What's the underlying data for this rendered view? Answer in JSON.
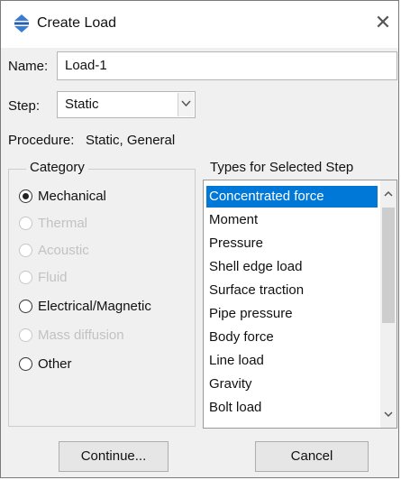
{
  "window": {
    "title": "Create Load",
    "close_glyph": "✕"
  },
  "form": {
    "name_label": "Name:",
    "name_value": "Load-1",
    "step_label": "Step:",
    "step_value": "Static",
    "procedure_label": "Procedure:",
    "procedure_value": "Static, General"
  },
  "category": {
    "legend": "Category",
    "options": [
      {
        "label": "Mechanical",
        "checked": true,
        "enabled": true
      },
      {
        "label": "Thermal",
        "checked": false,
        "enabled": false
      },
      {
        "label": "Acoustic",
        "checked": false,
        "enabled": false
      },
      {
        "label": "Fluid",
        "checked": false,
        "enabled": false
      },
      {
        "label": "Electrical/Magnetic",
        "checked": false,
        "enabled": true
      },
      {
        "label": "Mass diffusion",
        "checked": false,
        "enabled": false
      },
      {
        "label": "Other",
        "checked": false,
        "enabled": true
      }
    ]
  },
  "types": {
    "legend": "Types for Selected Step",
    "items": [
      "Concentrated force",
      "Moment",
      "Pressure",
      "Shell edge load",
      "Surface traction",
      "Pipe pressure",
      "Body force",
      "Line load",
      "Gravity",
      "Bolt load"
    ],
    "selected_index": 0
  },
  "buttons": {
    "continue": "Continue...",
    "cancel": "Cancel"
  },
  "colors": {
    "selection": "#0078d7",
    "dialog_bg": "#f0f0f0"
  },
  "icons": {
    "app": "abaqus-load-icon",
    "close": "close-icon",
    "combo": "chevron-down-icon"
  }
}
